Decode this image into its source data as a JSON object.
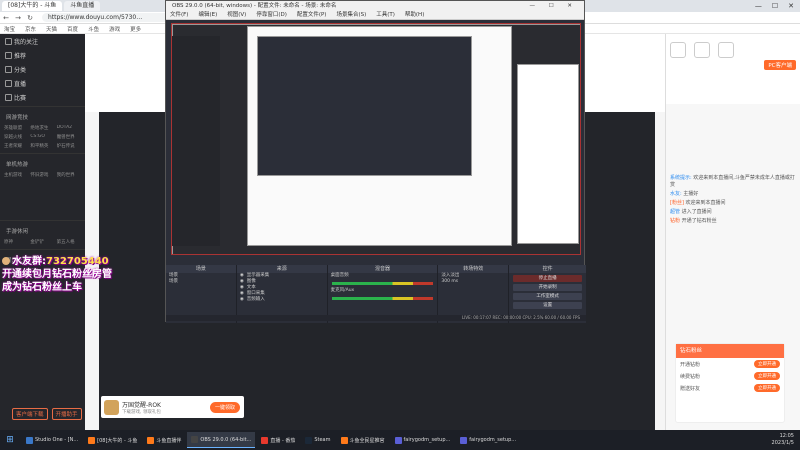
{
  "browser": {
    "tabs": [
      "[08]大牛的 - 斗鱼",
      "斗鱼直播"
    ],
    "url": "https://www.douyu.com/5730…",
    "bookmarks": [
      "淘宝",
      "京东",
      "天猫",
      "百度",
      "斗鱼",
      "游戏",
      "更多"
    ]
  },
  "sidebar": {
    "items": [
      "我的关注",
      "推荐",
      "分类",
      "直播",
      "比赛"
    ],
    "group1": "网游竞技",
    "grid1": [
      "英雄联盟",
      "绝地求生",
      "DOTA2",
      "穿越火线",
      "CS:GO",
      "魔兽世界",
      "王者荣耀",
      "和平精英",
      "炉石传说"
    ],
    "group2": "单机热游",
    "grid2": [
      "主机游戏",
      "怀旧游戏",
      "我的世界"
    ],
    "group3": "手游休闲",
    "grid3": [
      "原神",
      "金铲铲",
      "第五人格"
    ],
    "group4": "娱乐天地",
    "grid4": [
      "颜值",
      "户外",
      "二次元"
    ],
    "footer": [
      "客户端下载",
      "开播助手"
    ]
  },
  "overlay": {
    "line1_prefix": "水友群:",
    "line1_number": "732705440",
    "line2": "开通续包月钻石粉丝房管",
    "line3": "成为钻石粉丝上车"
  },
  "obs": {
    "title": "OBS 29.0.0 (64-bit, windows) - 配置文件: 未命名 - 场景: 未命名",
    "menu": [
      "文件(F)",
      "编辑(E)",
      "视图(V)",
      "停靠窗口(D)",
      "配置文件(P)",
      "场景集合(S)",
      "工具(T)",
      "帮助(H)"
    ],
    "docks": {
      "scenes": "场景",
      "sources": "来源",
      "mixer": "混音器",
      "transitions": "转场特效",
      "controls": "控件"
    },
    "scene_items": [
      "场景",
      "场景"
    ],
    "source_items": [
      "显示器采集",
      "图像",
      "文本",
      "窗口采集",
      "音频输入"
    ],
    "mixer_items": [
      "桌面音频",
      "麦克风/Aux"
    ],
    "transition_item": "淡入淡出",
    "transition_duration": "300 ms",
    "control_buttons": [
      "停止直播",
      "开始录制",
      "工作室模式",
      "设置",
      "退出"
    ],
    "status": "LIVE: 00:17:07  REC: 00:00:00  CPU: 2.5%  60.00 / 60.00 FPS"
  },
  "right": {
    "pc_button": "PC客户端",
    "chat": [
      {
        "name": "系统提示:",
        "text": "欢迎来到本直播间,斗鱼严禁未成年人直播或打赏"
      },
      {
        "name": "水友:",
        "text": "主播好"
      },
      {
        "name": "[粉丝]",
        "text": "欢迎来到本直播间"
      },
      {
        "name": "超管",
        "text": "进入了直播间"
      },
      {
        "name": "钻粉",
        "text": "开通了钻石粉丝"
      }
    ],
    "gift_title": "钻石粉丝",
    "gift_rows": [
      "开通钻粉",
      "续费钻粉",
      "赠送好友"
    ],
    "gift_btn": "立即开通"
  },
  "game_ad": {
    "name": "万国觉醒-ROK",
    "sub": "下载游戏, 领取礼包",
    "btn": "一键领取"
  },
  "taskbar": {
    "apps": [
      "Studio One - [N...",
      "[08]大牛的 - 斗鱼",
      "斗鱼直播伴",
      "OBS 29.0.0 (64-bit...",
      "直播 - 番茄",
      "Steam",
      "斗鱼全民星推官",
      "fairygodm_setup...",
      "fairygodm_setup..."
    ],
    "time": "12:05",
    "date": "2023/1/5"
  },
  "colors": {
    "accent": "#ff6a2a",
    "obs_bg": "#2b2e38",
    "overlay_glow": "#b000b0"
  }
}
